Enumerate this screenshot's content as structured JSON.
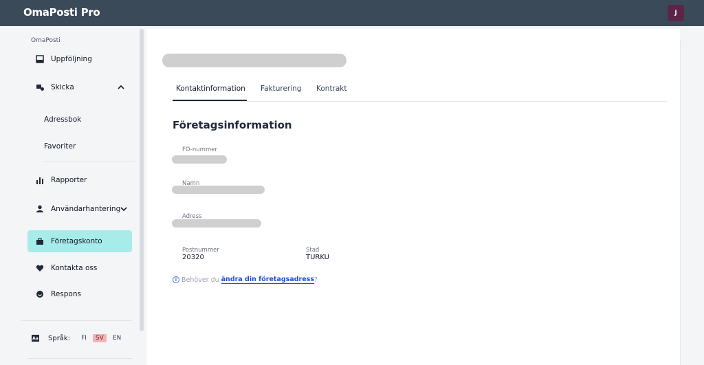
{
  "app": {
    "title": "OmaPosti Pro",
    "avatar_initial": "J"
  },
  "sidebar": {
    "section_label": "OmaPosti",
    "items": [
      {
        "label": "Uppföljning",
        "icon": "inbox-icon"
      },
      {
        "label": "Skicka",
        "icon": "send-package-icon"
      },
      {
        "label": "Rapporter",
        "icon": "bar-chart-icon"
      },
      {
        "label": "Användarhantering",
        "icon": "user-icon"
      },
      {
        "label": "Företagskonto",
        "icon": "briefcase-icon"
      },
      {
        "label": "Kontakta oss",
        "icon": "heart-icon"
      },
      {
        "label": "Respons",
        "icon": "smile-icon"
      }
    ],
    "sub_items": [
      {
        "label": "Adressbok"
      },
      {
        "label": "Favoriter"
      }
    ],
    "language": {
      "label": "Språk:",
      "options": [
        "FI",
        "SV",
        "EN"
      ],
      "selected": "SV"
    }
  },
  "main": {
    "tabs": [
      {
        "label": "Kontaktinformation"
      },
      {
        "label": "Fakturering"
      },
      {
        "label": "Kontrakt"
      }
    ],
    "active_tab": "Kontaktinformation",
    "section_title": "Företagsinformation",
    "fields": {
      "fo_label": "FO-nummer",
      "name_label": "Namn",
      "address_label": "Adress",
      "postal_label": "Postnummer",
      "postal_value": "20320",
      "city_label": "Stad",
      "city_value": "TURKU"
    },
    "hint": {
      "prefix": "Behöver du",
      "link": "ändra din företagsadress",
      "suffix": "?"
    }
  },
  "colors": {
    "topbar": "#3b4a59",
    "active_nav": "#a8ece9",
    "avatar": "#5c2548",
    "link": "#1d4ed8"
  }
}
